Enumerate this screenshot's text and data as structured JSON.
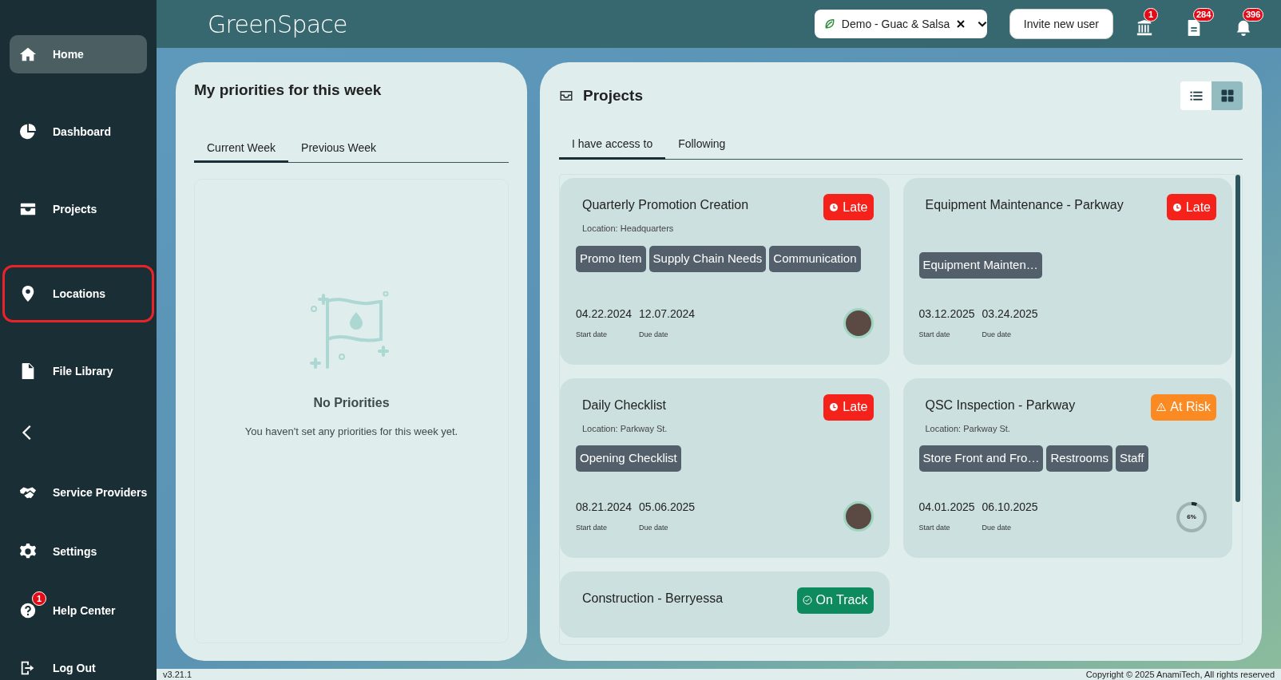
{
  "sidebar": {
    "items": [
      {
        "kind": "home",
        "label": "Home",
        "selected": true,
        "outlined": false
      },
      {
        "kind": "dashboard",
        "label": "Dashboard",
        "selected": false,
        "outlined": false
      },
      {
        "kind": "projects",
        "label": "Projects",
        "selected": false,
        "outlined": false
      },
      {
        "kind": "locations",
        "label": "Locations",
        "selected": false,
        "outlined": true
      },
      {
        "kind": "files",
        "label": "File Library",
        "selected": false,
        "outlined": false
      },
      {
        "kind": "collapse",
        "selected": false,
        "outlined": false
      },
      {
        "kind": "providers",
        "label": "Service Providers",
        "selected": false,
        "outlined": false
      },
      {
        "kind": "settings",
        "label": "Settings",
        "selected": false,
        "outlined": false
      },
      {
        "kind": "help",
        "label": "Help Center",
        "selected": false,
        "outlined": false,
        "badge": "1"
      },
      {
        "kind": "logout",
        "label": "Log Out",
        "selected": false,
        "outlined": false
      }
    ]
  },
  "header": {
    "logo": "GreenSpace",
    "workspace": "Demo - Guac & Salsa",
    "invite_button": "Invite new user",
    "notifications": [
      {
        "kind": "building",
        "badge": "1"
      },
      {
        "kind": "document",
        "badge": "284"
      },
      {
        "kind": "bell",
        "badge": "396"
      }
    ]
  },
  "priorities": {
    "title": "My priorities for this week",
    "tabs": [
      {
        "label": "Current Week",
        "selected": true
      },
      {
        "label": "Previous Week",
        "selected": false
      }
    ],
    "empty_title": "No Priorities",
    "empty_text": "You haven't set any priorities for this week yet."
  },
  "projects": {
    "title": "Projects",
    "views": [
      {
        "kind": "list",
        "selected": false
      },
      {
        "kind": "grid",
        "selected": true
      }
    ],
    "tabs": [
      {
        "label": "I have access to",
        "selected": true
      },
      {
        "label": "Following",
        "selected": false
      }
    ],
    "cards": [
      {
        "title": "Quarterly Promotion Creation",
        "location": "Location: Headquarters",
        "status": {
          "kind": "late",
          "label": "Late"
        },
        "tags": [
          "Promo Item",
          "Supply Chain Needs",
          "Communication"
        ],
        "start_date": "04.22.2024",
        "start_label": "Start date",
        "due_date": "12.07.2024",
        "due_label": "Due date",
        "footer": {
          "kind": "avatar"
        }
      },
      {
        "title": "Equipment Maintenance - Parkway",
        "status": {
          "kind": "late",
          "label": "Late"
        },
        "tags": [
          "Equipment Mainten…"
        ],
        "start_date": "03.12.2025",
        "start_label": "Start date",
        "due_date": "03.24.2025",
        "due_label": "Due date"
      },
      {
        "title": "Daily Checklist",
        "location": "Location: Parkway St.",
        "status": {
          "kind": "late",
          "label": "Late"
        },
        "tags": [
          "Opening Checklist"
        ],
        "start_date": "08.21.2024",
        "start_label": "Start date",
        "due_date": "05.06.2025",
        "due_label": "Due date",
        "footer": {
          "kind": "avatar"
        }
      },
      {
        "title": "QSC Inspection - Parkway",
        "location": "Location: Parkway St.",
        "status": {
          "kind": "at_risk",
          "label": "At Risk"
        },
        "tags": [
          "Store Front and Fro…",
          "Restrooms",
          "Staff"
        ],
        "start_date": "04.01.2025",
        "start_label": "Start date",
        "due_date": "06.10.2025",
        "due_label": "Due date",
        "footer": {
          "kind": "progress",
          "level": 0.06,
          "label": "6%"
        }
      },
      {
        "title": "Construction - Berryessa",
        "status": {
          "kind": "on_track",
          "label": "On Track"
        }
      }
    ]
  },
  "footer": {
    "version": "v3.21.1",
    "copyright": "Copyright © 2025 AnamiTech, All rights reserved"
  }
}
